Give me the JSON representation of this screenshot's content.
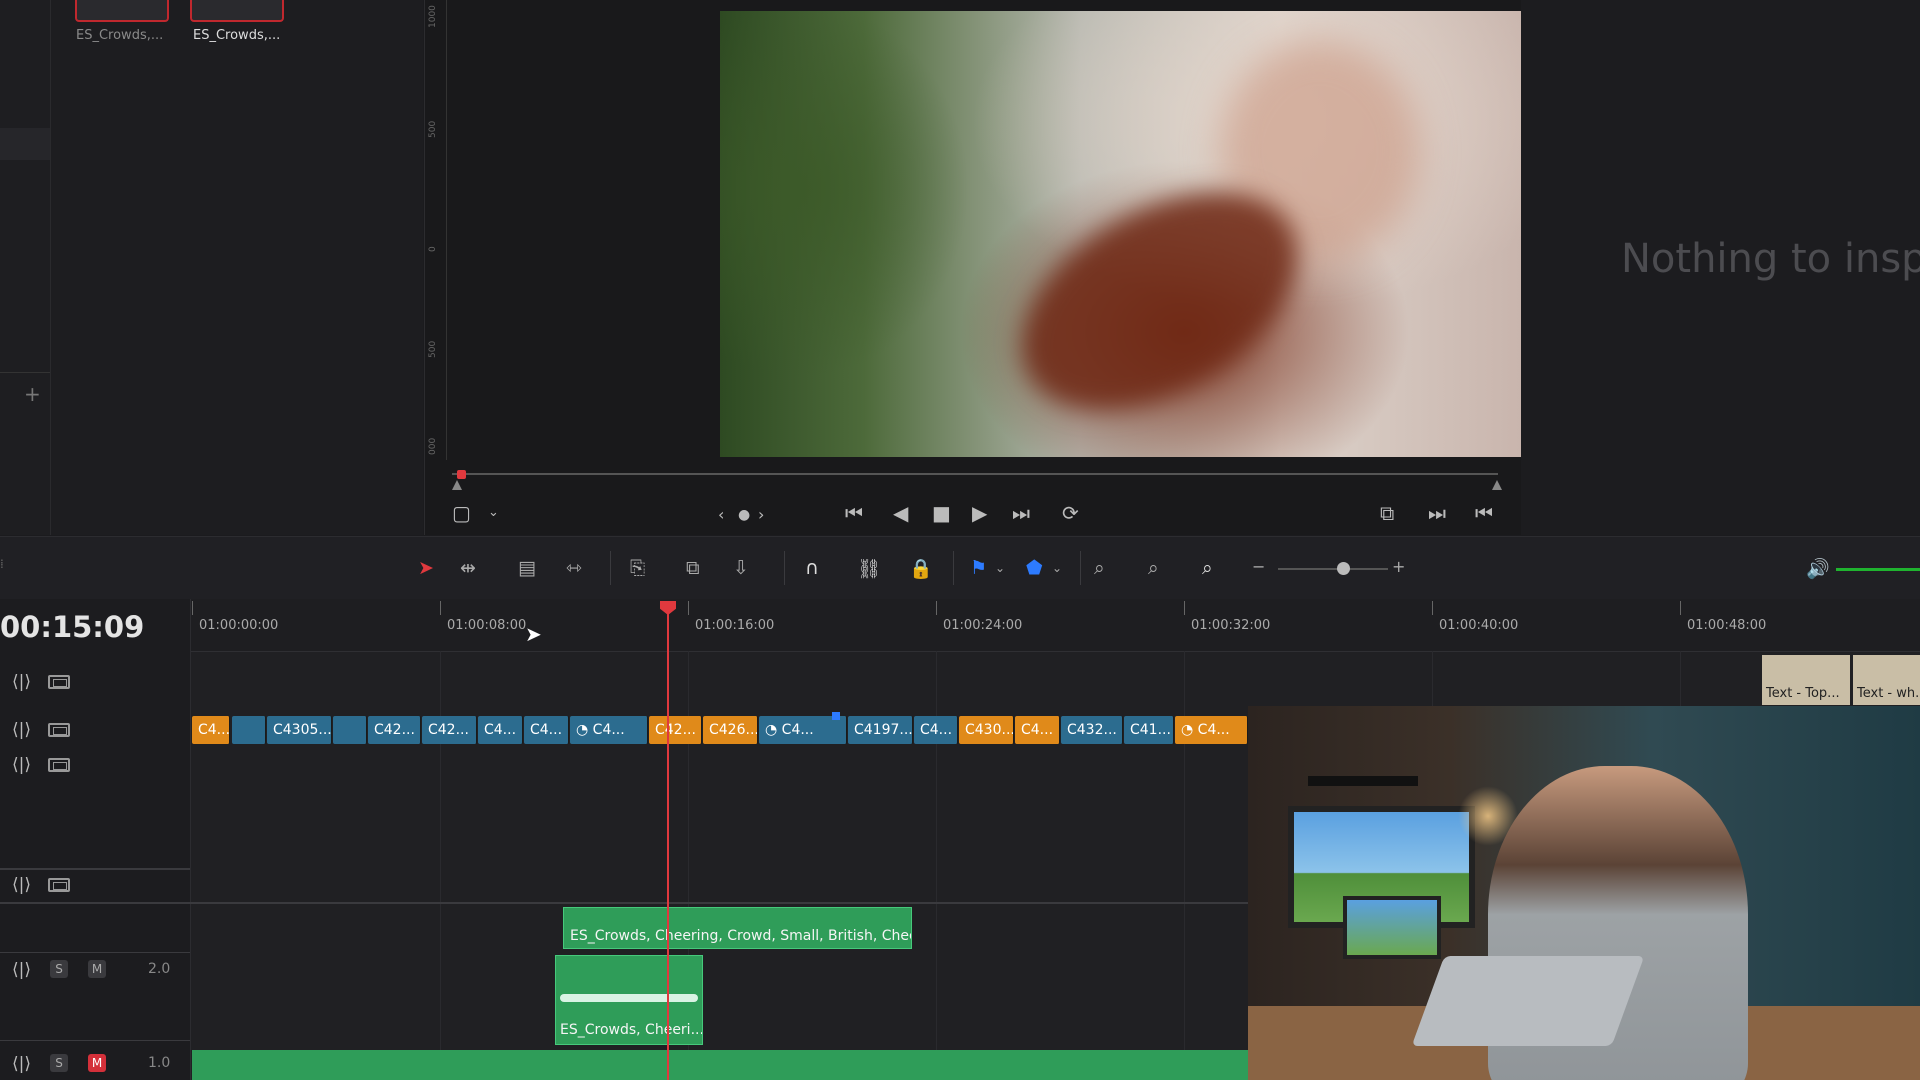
{
  "media_pool": {
    "thumbs": [
      {
        "label": "ES_Crowds,..."
      },
      {
        "label": "ES_Crowds,..."
      }
    ]
  },
  "viewer": {
    "ruler_ticks": [
      "1000",
      "500",
      "0",
      "500",
      "000"
    ],
    "inspector_message": "Nothing to inspe"
  },
  "timeline": {
    "timecode": "00:15:09",
    "ruler_labels": [
      "01:00:00:00",
      "01:00:08:00",
      "01:00:16:00",
      "01:00:24:00",
      "01:00:32:00",
      "01:00:40:00",
      "01:00:48:00"
    ],
    "video_clips": [
      {
        "label": "C4...",
        "color": "o"
      },
      {
        "label": "",
        "color": "b"
      },
      {
        "label": "C4305...",
        "color": "b"
      },
      {
        "label": "",
        "color": "b"
      },
      {
        "label": "C42...",
        "color": "b"
      },
      {
        "label": "C42...",
        "color": "b"
      },
      {
        "label": "C4...",
        "color": "b"
      },
      {
        "label": "C4...",
        "color": "b"
      },
      {
        "label": "C4...",
        "color": "b",
        "icon": "speed-icon"
      },
      {
        "label": "C42...",
        "color": "o"
      },
      {
        "label": "C426...",
        "color": "o"
      },
      {
        "label": "C4...",
        "color": "b",
        "icon": "speed-icon"
      },
      {
        "label": "C4197...",
        "color": "b"
      },
      {
        "label": "C4...",
        "color": "b"
      },
      {
        "label": "C430...",
        "color": "o"
      },
      {
        "label": "C4...",
        "color": "o"
      },
      {
        "label": "C432...",
        "color": "b"
      },
      {
        "label": "C41...",
        "color": "b"
      },
      {
        "label": "C4...",
        "color": "o",
        "icon": "speed-icon"
      }
    ],
    "text_clips": [
      {
        "label": "Text - Top..."
      },
      {
        "label": "Text - wh..."
      }
    ],
    "audio": {
      "track_a1_level": "2.0",
      "track_a2_level": "1.0",
      "solo_label": "S",
      "mute_label": "M",
      "clip_long_label": "ES_Crowds, Cheering, Crowd, Small, British, Chee...",
      "clip_short_label": "ES_Crowds, Cheeri..."
    }
  },
  "colors": {
    "playhead": "#e0393e",
    "clip_blue": "#2c6c8f",
    "clip_orange": "#e08a1a",
    "audio_green": "#2f9d59",
    "mute_red": "#d4303a",
    "volume_green": "#1fb32f"
  }
}
